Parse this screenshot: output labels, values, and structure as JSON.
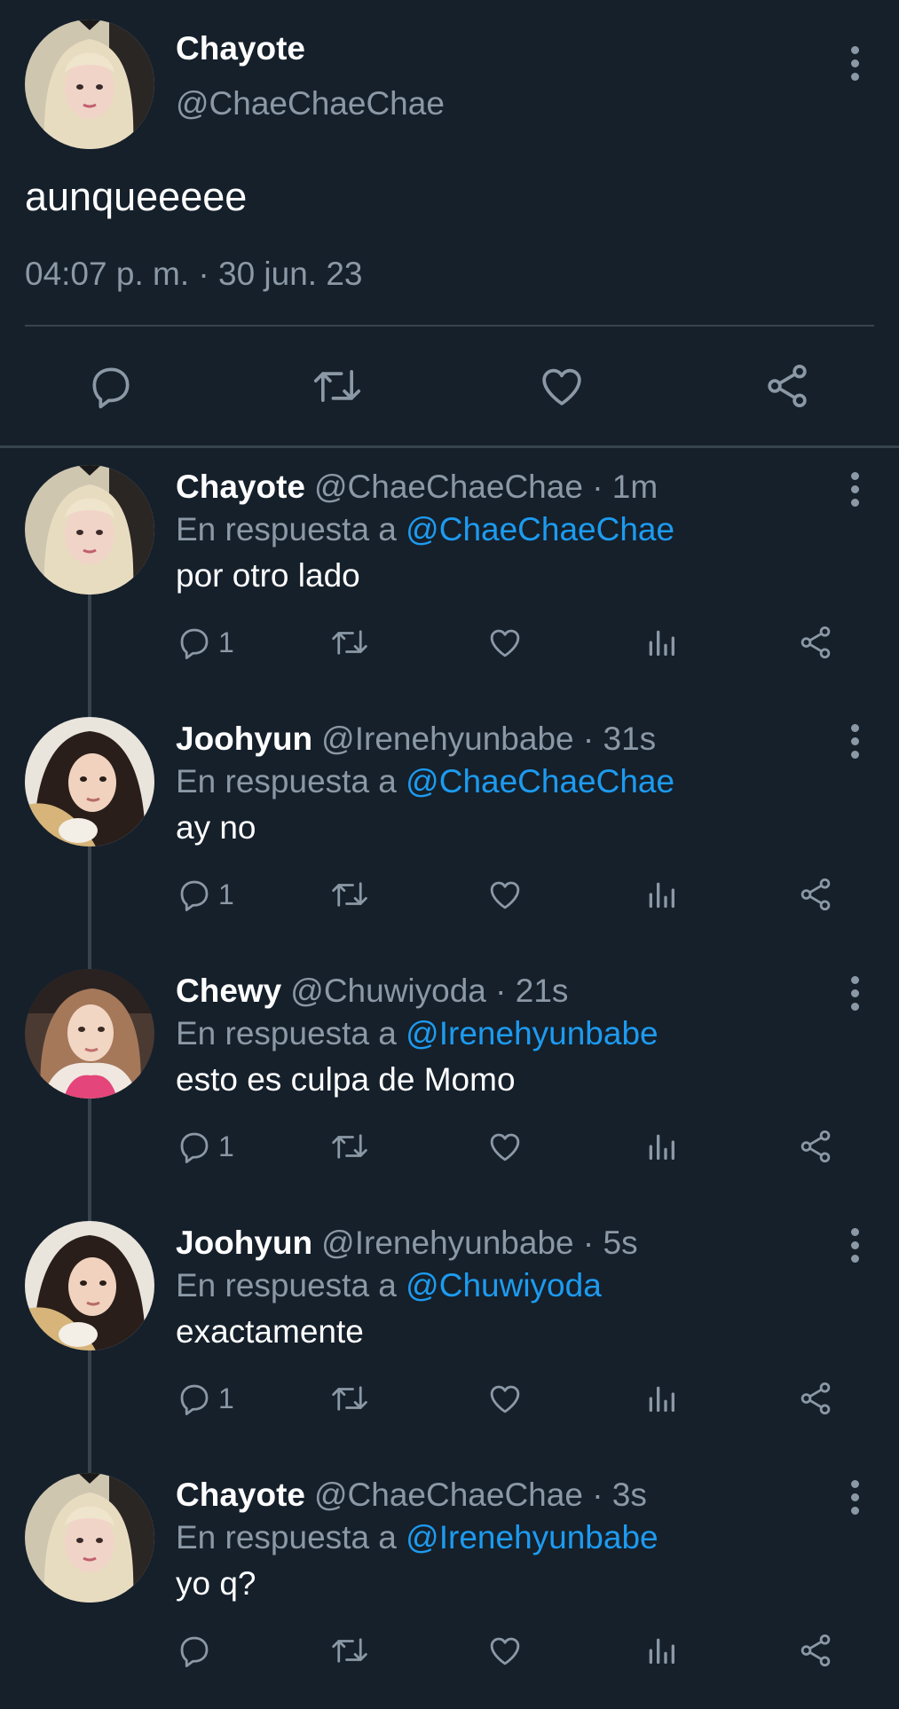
{
  "main_tweet": {
    "name": "Chayote",
    "handle": "@ChaeChaeChae",
    "text": "aunqueeeee",
    "timestamp": "04:07 p. m. · 30 jun. 23",
    "actions": [
      "reply-icon",
      "retweet-icon",
      "like-icon",
      "share-icon"
    ]
  },
  "replies": [
    {
      "name": "Chayote",
      "handle": "@ChaeChaeChae",
      "time": "· 1m",
      "reply_prefix": "En respuesta a",
      "reply_to": "@ChaeChaeChae",
      "text": "por otro lado",
      "reply_count": "1"
    },
    {
      "name": "Joohyun",
      "handle": "@Irenehyunbabe",
      "time": "· 31s",
      "reply_prefix": "En respuesta a",
      "reply_to": "@ChaeChaeChae",
      "text": "ay no",
      "reply_count": "1"
    },
    {
      "name": "Chewy",
      "handle": "@Chuwiyoda",
      "time": "· 21s",
      "reply_prefix": "En respuesta a",
      "reply_to": "@Irenehyunbabe",
      "text": "esto es culpa de Momo",
      "reply_count": "1"
    },
    {
      "name": "Joohyun",
      "handle": "@Irenehyunbabe",
      "time": "· 5s",
      "reply_prefix": "En respuesta a",
      "reply_to": "@Chuwiyoda",
      "text": "exactamente",
      "reply_count": "1"
    },
    {
      "name": "Chayote",
      "handle": "@ChaeChaeChae",
      "time": "· 3s",
      "reply_prefix": "En respuesta a",
      "reply_to": "@Irenehyunbabe",
      "text": "yo q?",
      "reply_count": ""
    }
  ],
  "colors": {
    "background": "#15202b",
    "muted": "#8b98a5",
    "link": "#1d9bf0",
    "divider": "#38444d"
  }
}
